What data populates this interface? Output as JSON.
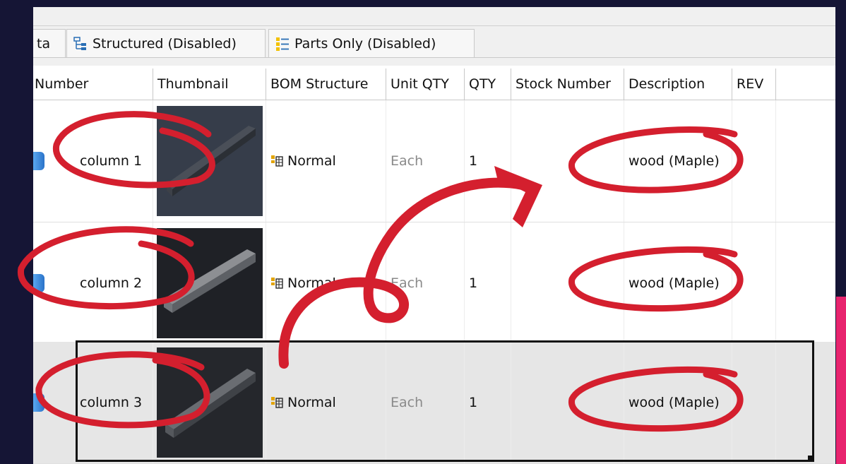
{
  "tabs": [
    {
      "label": "ta"
    },
    {
      "label": "Structured (Disabled)",
      "icon": "structured-tree-icon"
    },
    {
      "label": "Parts Only (Disabled)",
      "icon": "parts-list-icon"
    }
  ],
  "columns": [
    "Number",
    "Thumbnail",
    "BOM Structure",
    "Unit QTY",
    "QTY",
    "Stock Number",
    "Description",
    "REV"
  ],
  "rows": [
    {
      "number": "column 1",
      "bom": "Normal",
      "unit_qty": "Each",
      "qty": "1",
      "stock": "",
      "description": "wood (Maple)",
      "rev": ""
    },
    {
      "number": "column 2",
      "bom": "Normal",
      "unit_qty": "Each",
      "qty": "1",
      "stock": "",
      "description": "wood (Maple)",
      "rev": ""
    },
    {
      "number": "column 3",
      "bom": "Normal",
      "unit_qty": "Each",
      "qty": "1",
      "stock": "",
      "description": "wood (Maple)",
      "rev": "",
      "selected": true
    }
  ],
  "colors": {
    "background": "#151535",
    "annotation": "#d41f2e",
    "accent_bar": "#e8246e"
  }
}
